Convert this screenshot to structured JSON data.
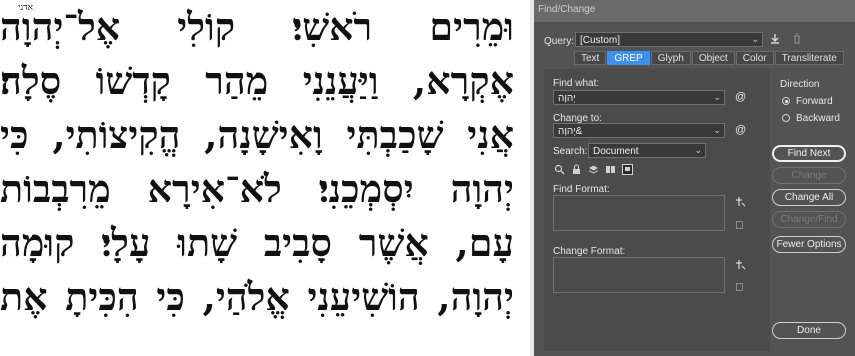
{
  "document": {
    "lines": [
      "וּמֵרִים רֹאשִׁי׃ קוֹלִי אֶל־יְהוָה",
      "אֶקְרָא, וַיַּעֲנֵנִי מֵהַר קָדְשׁוֹ סֶלָה׃",
      "אֲנִי שָׁכַבְתִּי וָאִישָׁנָה, הֱקִיצוֹתִי, כִּי",
      "יְהוָה יִסְמְכֵנִי׃ לֹא־אִירָא מֵרִבְבוֹת",
      "עָם, אֲשֶׁר סָבִיב שָׁתוּ עָלָי׃ קוּמָה",
      "יְהוָה, הוֹשִׁיעֵנִי אֱלֹהַי, כִּי הִכִּיתָ אֶת"
    ],
    "qere_note": "אדני"
  },
  "dialog": {
    "title": "Find/Change",
    "query_label": "Query:",
    "query_value": "[Custom]",
    "tabs": [
      "Text",
      "GREP",
      "Glyph",
      "Object",
      "Color",
      "Transliterate"
    ],
    "active_tab": "GREP",
    "find_what_label": "Find what:",
    "find_what_value": "יְהוָה",
    "change_to_label": "Change to:",
    "change_to_value": "יְהוָה&",
    "at_symbol": "@",
    "search_label": "Search:",
    "search_value": "Document",
    "find_format_label": "Find Format:",
    "change_format_label": "Change Format:",
    "direction_label": "Direction",
    "forward_label": "Forward",
    "backward_label": "Backward",
    "direction_selected": "Forward",
    "buttons": {
      "find_next": "Find Next",
      "change": "Change",
      "change_all": "Change All",
      "change_find": "Change/Find",
      "fewer_options": "Fewer Options",
      "done": "Done"
    },
    "colors": {
      "accent": "#3d8ff0",
      "panel": "#535353"
    }
  }
}
